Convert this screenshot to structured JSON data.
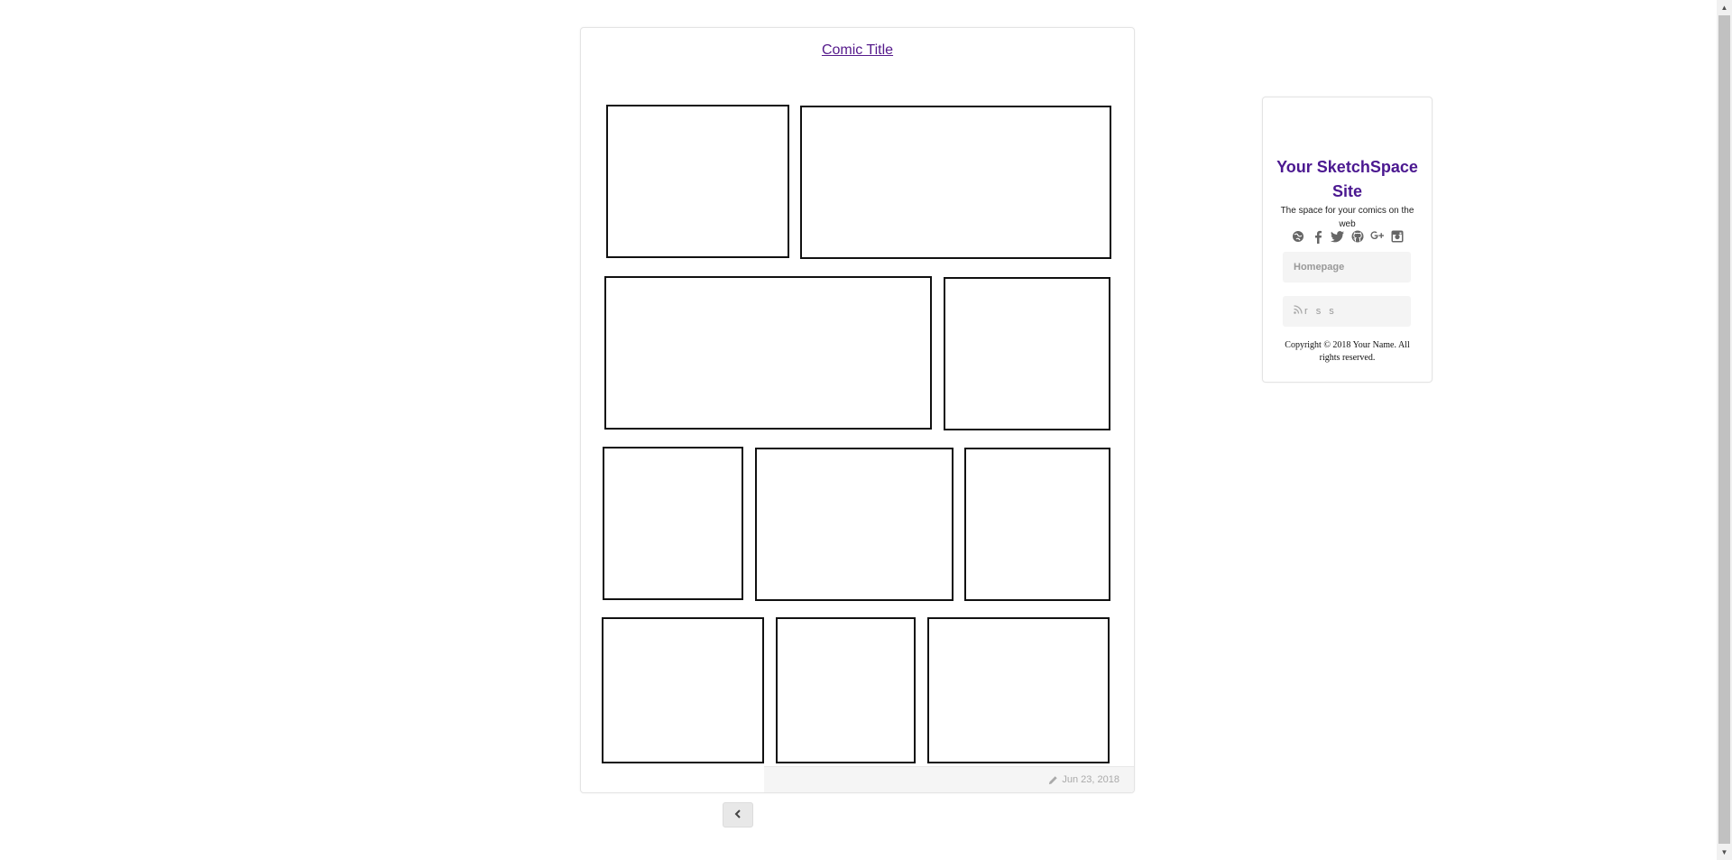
{
  "comic": {
    "title": "Comic Title",
    "date": "Jun 23, 2018"
  },
  "navigation": {
    "prev_icon": "chevron-left-icon"
  },
  "sidebar": {
    "site_title": "Your SketchSpace Site",
    "tagline": "The space for your comics on the web",
    "social_icons": [
      "globe-icon",
      "facebook-icon",
      "twitter-icon",
      "github-icon",
      "google-plus-icon",
      "instagram-icon"
    ],
    "homepage_label": "Homepage",
    "rss_label": "r s s",
    "copyright": "Copyright © 2018 Your Name. All rights reserved."
  },
  "colors": {
    "link": "#551a8b",
    "site_title": "#4b1890"
  }
}
